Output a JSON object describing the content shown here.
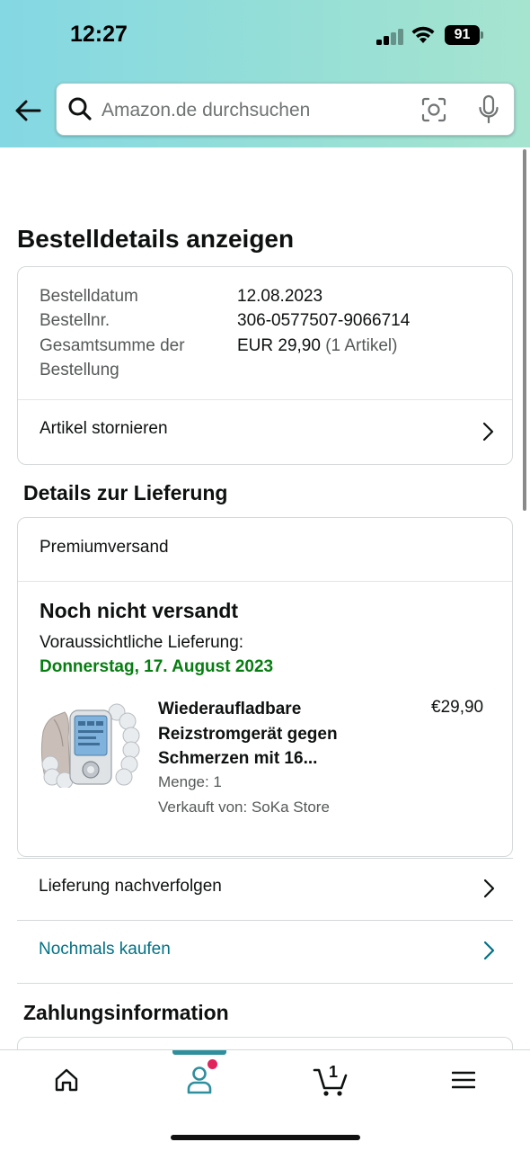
{
  "status_bar": {
    "time": "12:27",
    "battery": "91"
  },
  "search": {
    "placeholder": "Amazon.de durchsuchen"
  },
  "page": {
    "title": "Bestelldetails anzeigen"
  },
  "order_summary": {
    "rows": [
      {
        "label": "Bestelldatum",
        "value": "12.08.2023"
      },
      {
        "label": "Bestellnr.",
        "value": "306-0577507-9066714"
      },
      {
        "label_line1": "Gesamtsumme der",
        "label_line2": "Bestellung",
        "value": "EUR 29,90",
        "value_extra": " (1 Artikel)"
      }
    ],
    "cancel_label": "Artikel stornieren"
  },
  "delivery": {
    "section_title": "Details zur Lieferung",
    "shipping_type": "Premiumversand",
    "status": "Noch nicht versandt",
    "eta_label": "Voraussichtliche Lieferung:",
    "eta_date": "Donnerstag, 17. August 2023",
    "colors": {
      "eta": "#067d10",
      "link": "#007185"
    },
    "item": {
      "title_line1": "Wiederaufladbare",
      "title_line2": "Reizstromgerät gegen",
      "title_line3": "Schmerzen mit 16...",
      "price": "€29,90",
      "quantity": "Menge: 1",
      "seller": "Verkauft von: SoKa Store"
    },
    "track_label": "Lieferung nachverfolgen",
    "buy_again_label": "Nochmals kaufen"
  },
  "payment": {
    "section_title": "Zahlungsinformation"
  },
  "tabbar": {
    "items": [
      {
        "icon": "home-icon"
      },
      {
        "icon": "account-icon",
        "active": true
      },
      {
        "icon": "cart-icon",
        "count": "1"
      },
      {
        "icon": "menu-icon"
      }
    ]
  }
}
